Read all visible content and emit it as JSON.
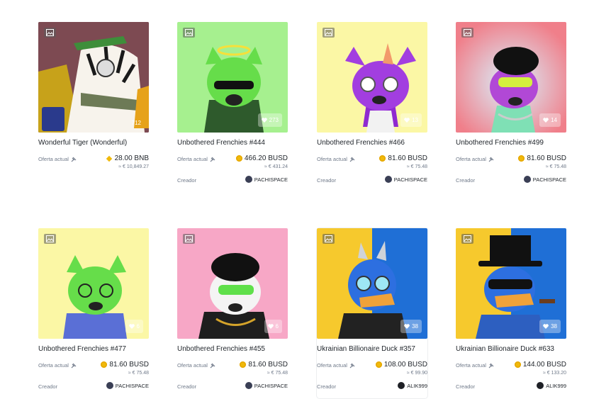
{
  "labels": {
    "offer": "Oferta actual",
    "creator": "Creador"
  },
  "cards": [
    {
      "title": "Wonderful Tiger (Wonderful)",
      "likes": "712",
      "price": "28.00 BNB",
      "eur": "≈ € 10,849.27",
      "creator": "",
      "coin": "bnb"
    },
    {
      "title": "Unbothered Frenchies #444",
      "likes": "273",
      "price": "466.20 BUSD",
      "eur": "≈ € 431.24",
      "creator": "PACHISPACE",
      "coin": "busd"
    },
    {
      "title": "Unbothered Frenchies #466",
      "likes": "13",
      "price": "81.60 BUSD",
      "eur": "≈ € 75.48",
      "creator": "PACHISPACE",
      "coin": "busd"
    },
    {
      "title": "Unbothered Frenchies #499",
      "likes": "14",
      "price": "81.60 BUSD",
      "eur": "≈ € 75.48",
      "creator": "PACHISPACE",
      "coin": "busd"
    },
    {
      "title": "Unbothered Frenchies #477",
      "likes": "6",
      "price": "81.60 BUSD",
      "eur": "≈ € 75.48",
      "creator": "PACHISPACE",
      "coin": "busd"
    },
    {
      "title": "Unbothered Frenchies #455",
      "likes": "6",
      "price": "81.60 BUSD",
      "eur": "≈ € 75.48",
      "creator": "PACHISPACE",
      "coin": "busd"
    },
    {
      "title": "Ukrainian Billionaire Duck #357",
      "likes": "38",
      "price": "108.00 BUSD",
      "eur": "≈ € 99.90",
      "creator": "ALIK999",
      "coin": "busd"
    },
    {
      "title": "Ukrainian Billionaire Duck #633",
      "likes": "38",
      "price": "144.00 BUSD",
      "eur": "≈ € 133.20",
      "creator": "ALIK999",
      "coin": "busd"
    }
  ],
  "colors": {
    "accent": "#f0b90b",
    "text": "#1e2329",
    "muted": "#707a8a"
  },
  "icons": [
    "image-icon",
    "heart-icon",
    "auction-icon",
    "busd-coin-icon",
    "bnb-coin-icon"
  ]
}
